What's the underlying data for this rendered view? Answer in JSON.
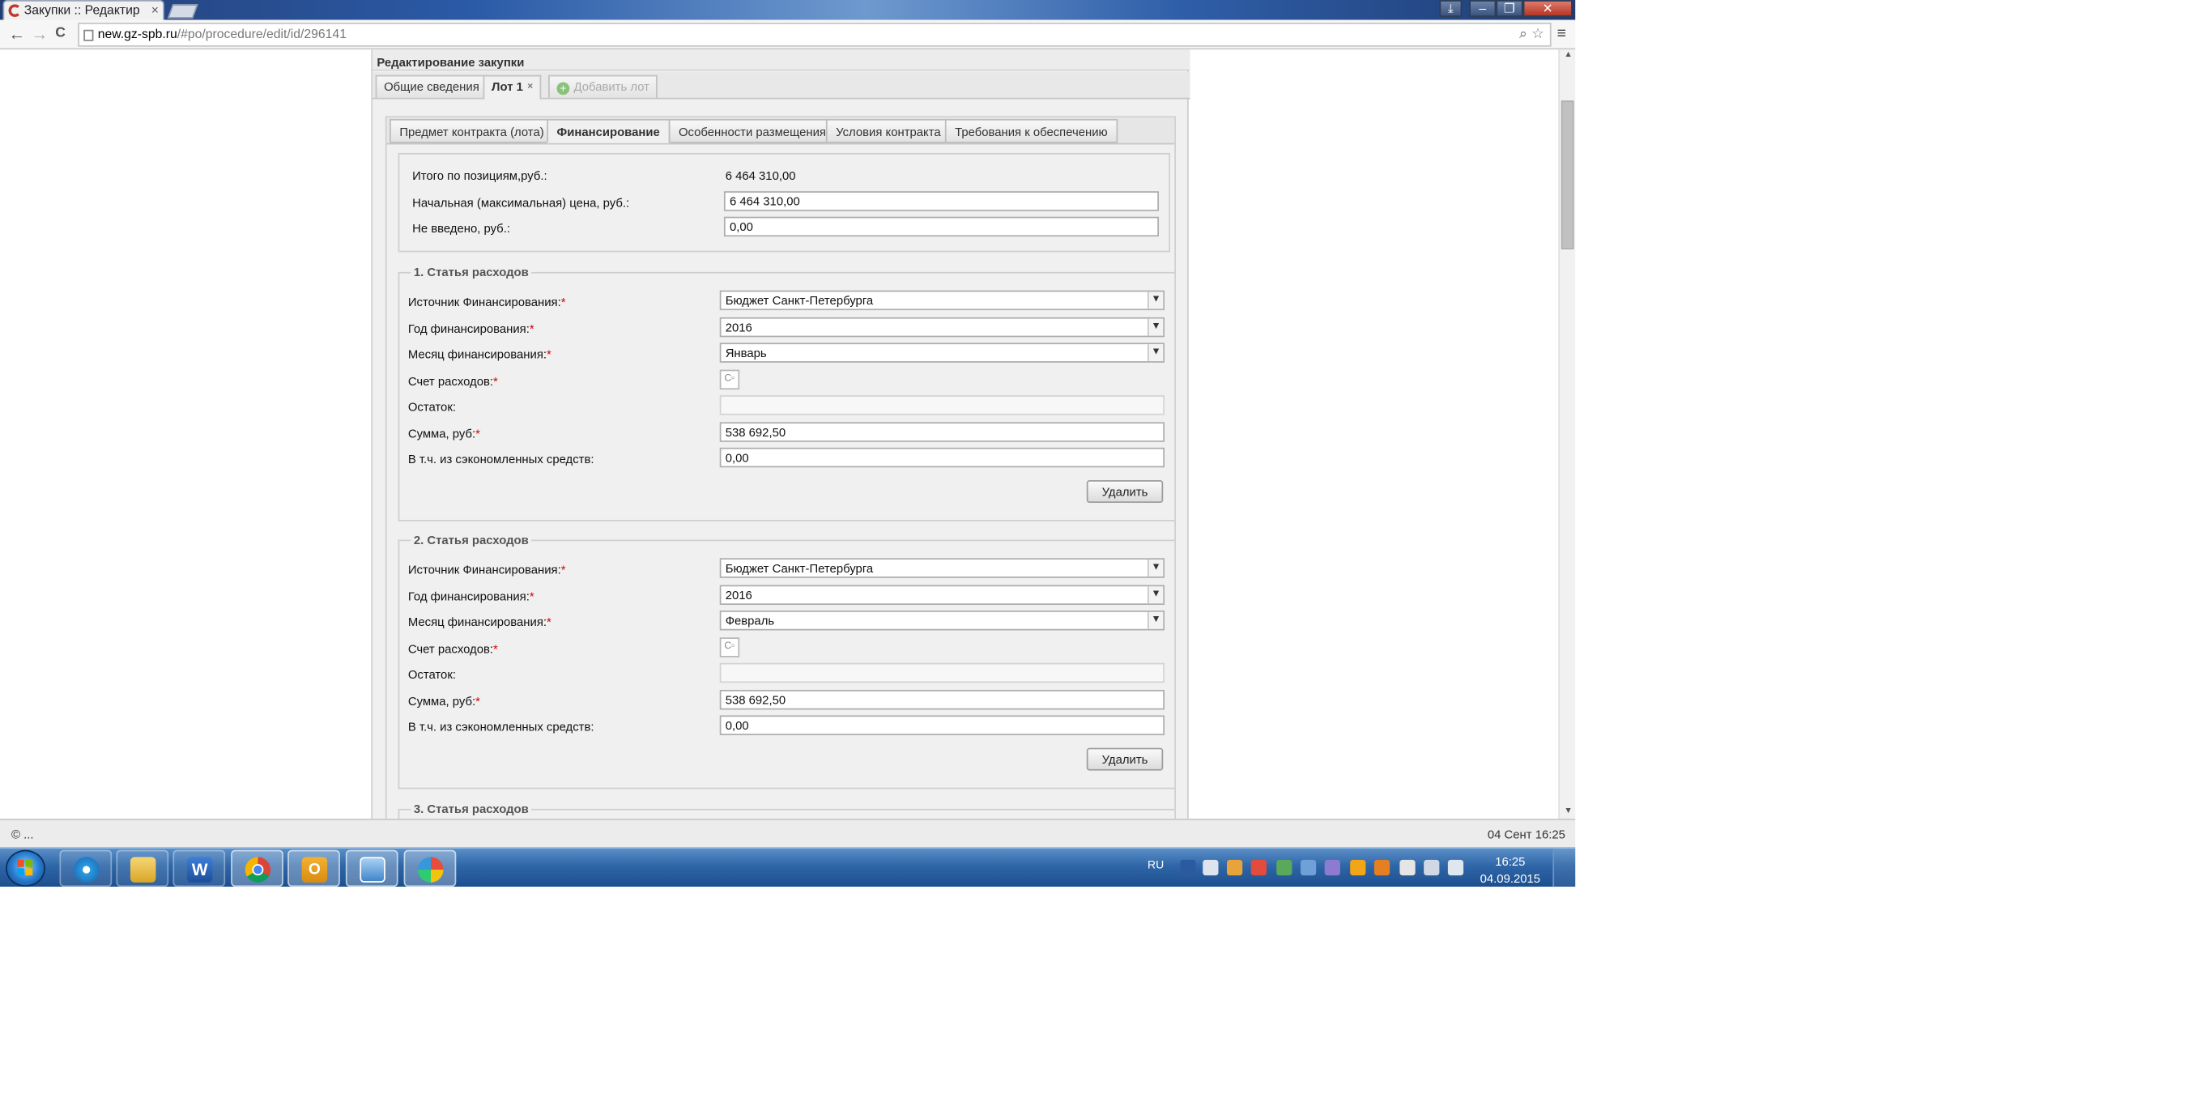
{
  "browser": {
    "tab_title": "Закупки :: Редактир",
    "tab_close": "×",
    "url_domain": "new.gz-spb.ru",
    "url_path": "/#po/procedure/edit/id/296141",
    "minimize": "–",
    "restore": "❐",
    "close": "✕",
    "back": "←",
    "forward": "→",
    "reload": "C",
    "menu": "≡"
  },
  "page": {
    "title": "Редактирование закупки",
    "top_tabs": [
      {
        "label": "Общие сведения"
      },
      {
        "label": "Лот 1",
        "close": "×"
      },
      {
        "label": "Добавить лот"
      }
    ],
    "sub_tabs": [
      {
        "label": "Предмет контракта (лота)"
      },
      {
        "label": "Финансирование"
      },
      {
        "label": "Особенности размещения"
      },
      {
        "label": "Условия контракта"
      },
      {
        "label": "Требования к обеспечению"
      }
    ],
    "summary": {
      "total_label": "Итого по позициям,руб.:",
      "total_value": "6 464 310,00",
      "start_price_label": "Начальная (максимальная) цена, руб.:",
      "start_price_value": "6 464 310,00",
      "not_entered_label": "Не введено, руб.:",
      "not_entered_value": "0,00"
    },
    "field_labels": {
      "source": "Источник Финансирования:",
      "year": "Год финансирования:",
      "month": "Месяц финансирования:",
      "account": "Счет расходов:",
      "remainder": "Остаток:",
      "sum": "Сумма, руб:",
      "saved": "В т.ч. из сэкономленных средств:",
      "required_mark": "*",
      "picker": "С▫"
    },
    "expense_items": [
      {
        "legend": "1. Статья расходов",
        "source": "Бюджет Санкт-Петербурга",
        "year": "2016",
        "month": "Январь",
        "remainder": "",
        "sum": "538 692,50",
        "saved": "0,00",
        "delete_label": "Удалить"
      },
      {
        "legend": "2. Статья расходов",
        "source": "Бюджет Санкт-Петербурга",
        "year": "2016",
        "month": "Февраль",
        "remainder": "",
        "sum": "538 692,50",
        "saved": "0,00",
        "delete_label": "Удалить"
      },
      {
        "legend": "3. Статья расходов"
      }
    ]
  },
  "statusbar": {
    "left": "© ...",
    "right": "04 Сент 16:25"
  },
  "taskbar": {
    "lang": "RU",
    "time": "16:25",
    "date": "04.09.2015",
    "apps": [
      "internet-explorer-icon",
      "folder-icon",
      "word-icon",
      "chrome-icon",
      "outlook-icon",
      "image-viewer-icon",
      "paint-icon"
    ]
  }
}
